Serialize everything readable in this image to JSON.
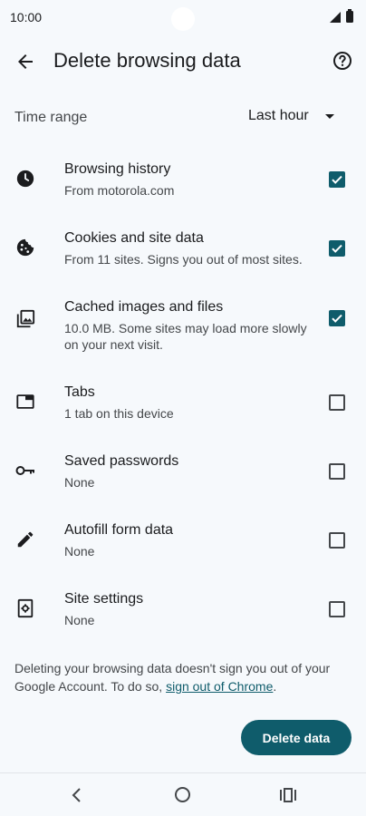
{
  "status_bar": {
    "time": "10:00"
  },
  "app_bar": {
    "title": "Delete browsing data"
  },
  "time_range": {
    "label": "Time range",
    "value": "Last hour"
  },
  "options": [
    {
      "title": "Browsing history",
      "subtitle": "From motorola.com",
      "checked": true,
      "icon": "clock-icon"
    },
    {
      "title": "Cookies and site data",
      "subtitle": "From 11 sites. Signs you out of most sites.",
      "checked": true,
      "icon": "cookie-icon"
    },
    {
      "title": "Cached images and files",
      "subtitle": "10.0 MB. Some sites may load more slowly on your next visit.",
      "checked": true,
      "icon": "images-icon"
    },
    {
      "title": "Tabs",
      "subtitle": "1 tab on this device",
      "checked": false,
      "icon": "tab-icon"
    },
    {
      "title": "Saved passwords",
      "subtitle": "None",
      "checked": false,
      "icon": "key-icon"
    },
    {
      "title": "Autofill form data",
      "subtitle": "None",
      "checked": false,
      "icon": "pencil-icon"
    },
    {
      "title": "Site settings",
      "subtitle": "None",
      "checked": false,
      "icon": "settings-page-icon"
    }
  ],
  "footer": {
    "text_before": "Deleting your browsing data doesn't sign you out of your Google Account. To do so, ",
    "link": "sign out of Chrome",
    "text_after": "."
  },
  "actions": {
    "delete_label": "Delete data"
  },
  "colors": {
    "accent": "#0f5c6b",
    "background": "#f6f9fc",
    "text": "#1b1c1e",
    "secondary_text": "#44474a"
  }
}
